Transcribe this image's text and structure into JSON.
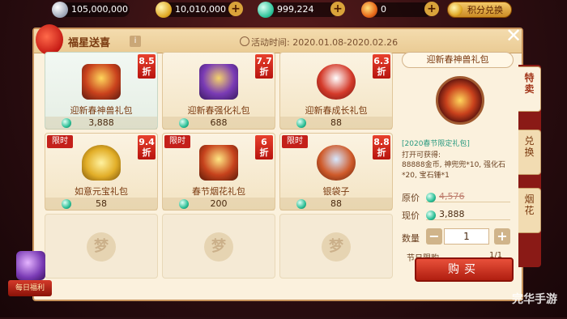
{
  "currency": {
    "silver": "105,000,000",
    "gold": "10,010,000",
    "jade": "999,224",
    "fire": "0",
    "points_btn": "积分兑换"
  },
  "header": {
    "title": "福星送喜",
    "info_icon": "i",
    "time": "活动时间: 2020.01.08-2020.02.26",
    "close": "✕"
  },
  "items": [
    {
      "name": "迎新春神兽礼包",
      "price": "3,888",
      "discount": "8.5\n折",
      "tag": "",
      "img": "img-chest-red",
      "selected": true
    },
    {
      "name": "迎新春强化礼包",
      "price": "688",
      "discount": "7.7\n折",
      "tag": "",
      "img": "img-chest-purple"
    },
    {
      "name": "迎新春成长礼包",
      "price": "88",
      "discount": "6.3\n折",
      "tag": "",
      "img": "img-bag-red"
    },
    {
      "name": "如意元宝礼包",
      "price": "58",
      "discount": "9.4\n折",
      "tag": "限时",
      "img": "img-ingot"
    },
    {
      "name": "春节烟花礼包",
      "price": "200",
      "discount": "6\n折",
      "tag": "限时",
      "img": "img-chest-gold"
    },
    {
      "name": "银袋子",
      "price": "88",
      "discount": "8.8\n折",
      "tag": "限时",
      "img": "img-pouch"
    }
  ],
  "placeholder_glyph": "梦",
  "detail": {
    "title": "迎新春神兽礼包",
    "sub": "[2020春节限定礼包]",
    "can_get": "打开可获得:",
    "desc": "88888金币, 神兜兜*10, 强化石*20, 宝石锤*1",
    "orig_label": "原价",
    "orig_price": "4,576",
    "now_label": "现价",
    "now_price": "3,888",
    "qty_label": "数量",
    "qty": "1",
    "minus": "−",
    "plus": "+",
    "limit_label": "节日限购",
    "limit_val": "1/1",
    "buy": "购买"
  },
  "side_tabs": [
    "特\n卖",
    "兑\n换",
    "烟\n花"
  ],
  "daily": {
    "label": "每日福利"
  },
  "watermark": "完华手游"
}
